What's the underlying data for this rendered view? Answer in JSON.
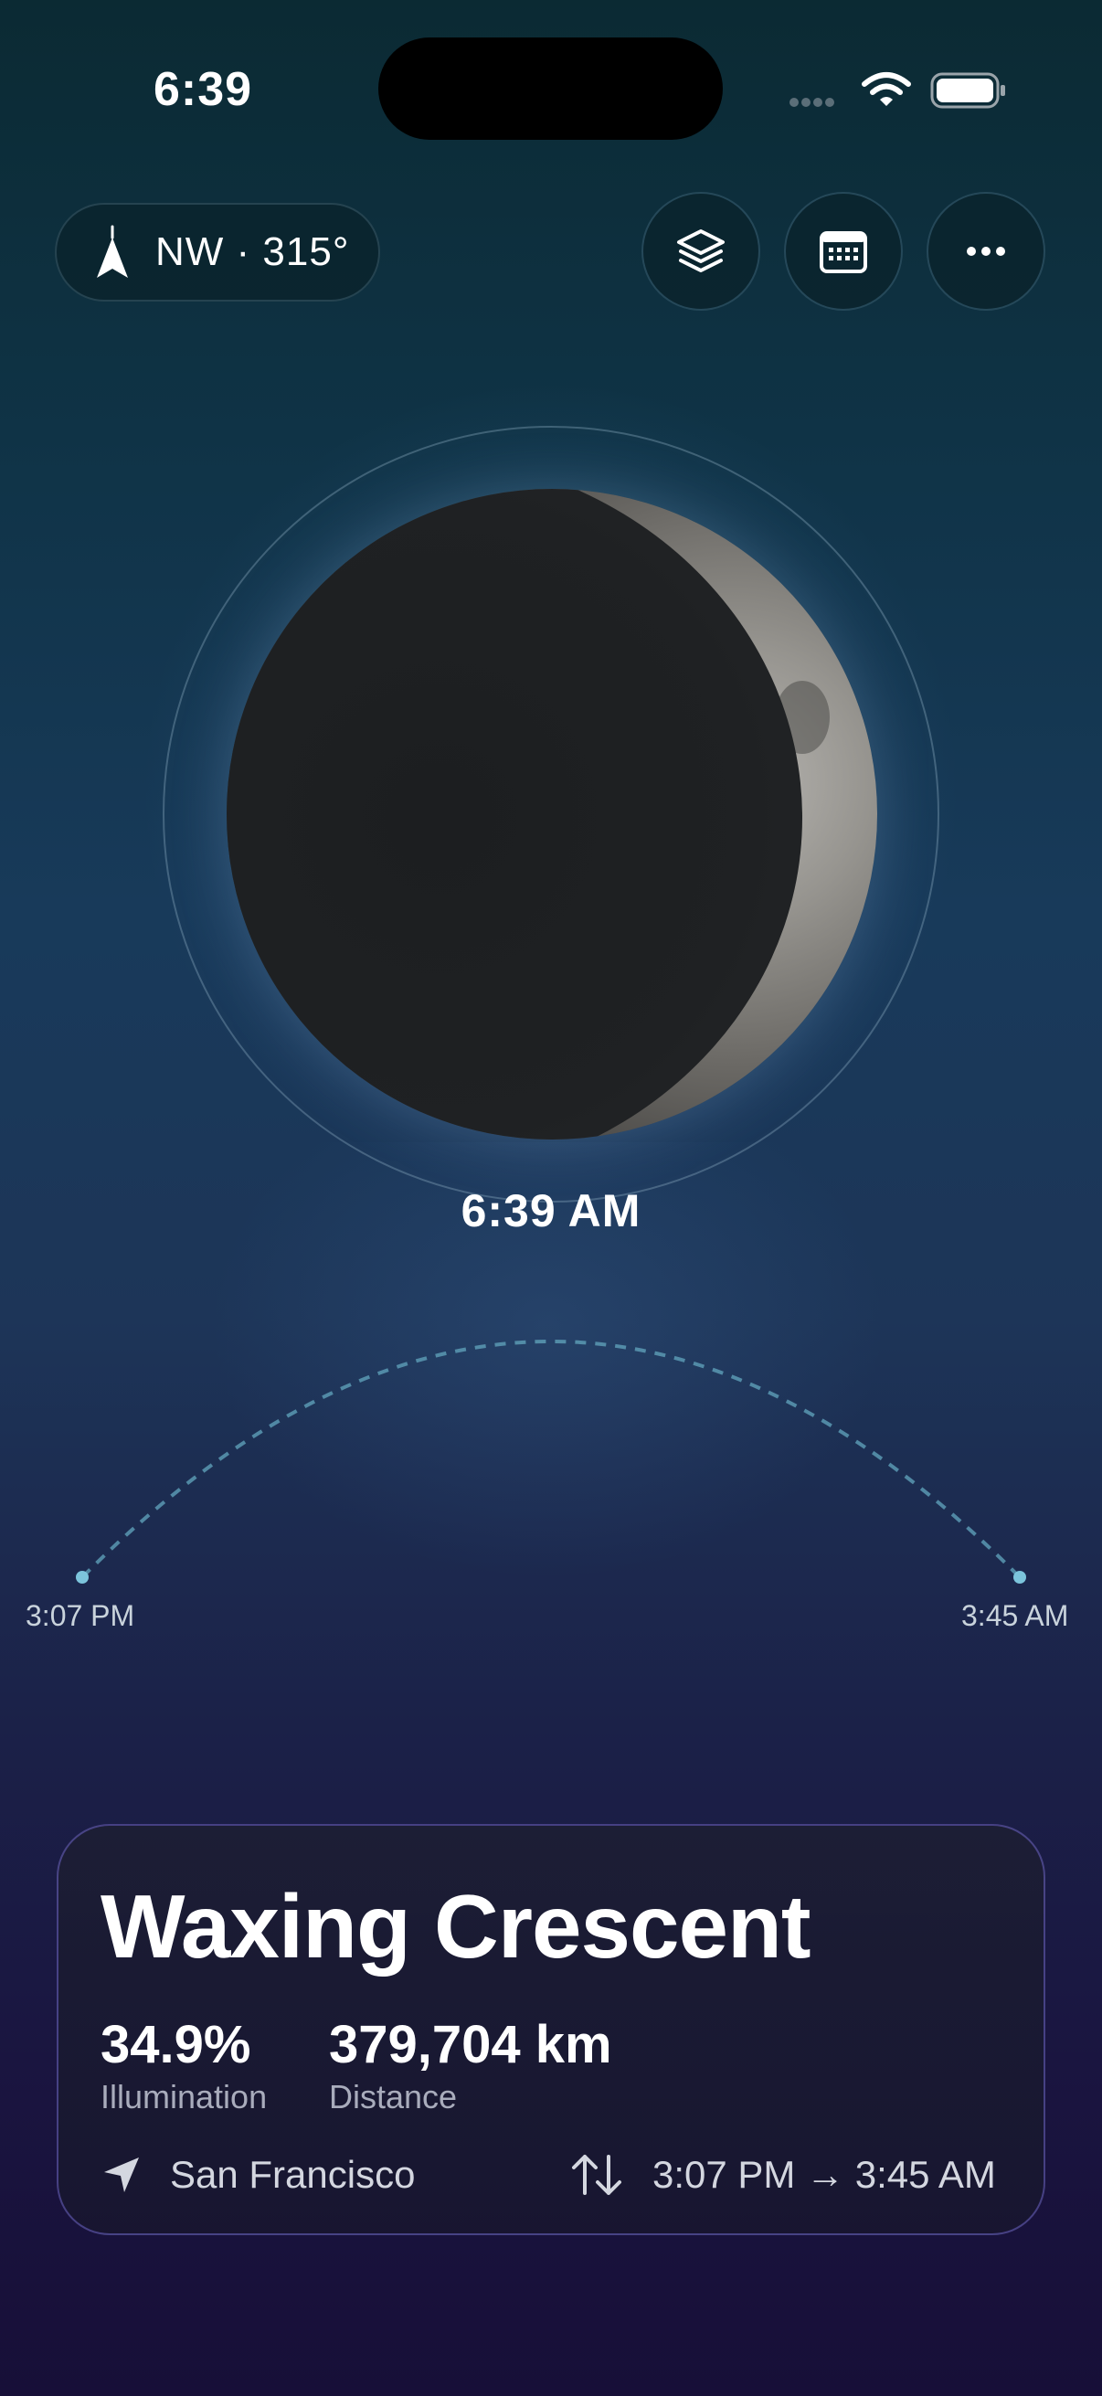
{
  "status_bar": {
    "time": "6:39"
  },
  "compass": {
    "label": "NW · 315°",
    "icon": "compass-arrow-icon"
  },
  "toolbar": {
    "layers_icon": "layers-icon",
    "calendar_icon": "calendar-icon",
    "more_icon": "more-icon"
  },
  "moon": {
    "time_label": "6:39 AM"
  },
  "arc": {
    "start_label": "3:07 PM",
    "end_label": "3:45 AM"
  },
  "card": {
    "phase": "Waxing Crescent",
    "illumination_value": "34.9%",
    "illumination_label": "Illumination",
    "distance_value": "379,704 km",
    "distance_label": "Distance",
    "location": "San Francisco",
    "times": "3:07 PM → 3:45 AM"
  },
  "colors": {
    "arc_accent": "#6fb6cf",
    "card_border": "#6e64c8"
  }
}
